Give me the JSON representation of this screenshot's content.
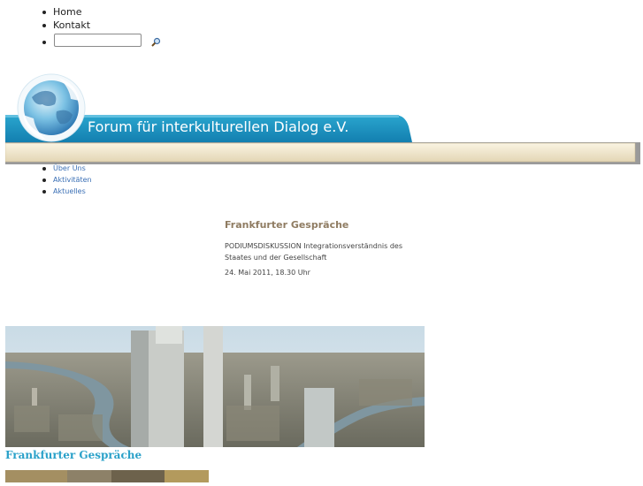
{
  "topnav": {
    "items": [
      {
        "label": "Home"
      },
      {
        "label": "Kontakt"
      }
    ],
    "search": {
      "value": ""
    }
  },
  "banner": {
    "title": "Forum für interkulturellen Dialog e.V."
  },
  "subnav": {
    "items": [
      {
        "label": "Über Uns"
      },
      {
        "label": "Aktivitäten"
      },
      {
        "label": "Aktuelles"
      }
    ]
  },
  "article": {
    "title": "Frankfurter Gespräche",
    "body": "PODIUMSDISKUSSION Integrationsverständnis des Staates und der Gesellschaft",
    "date": "24. Mai 2011, 18.30 Uhr"
  },
  "gallery": {
    "caption": "Frankfurter Gespräche"
  },
  "colors": {
    "accent": "#2aa1c9",
    "banner_blue": "#1e8fb9",
    "article_title": "#8f7c62",
    "link": "#3a6fb5"
  }
}
